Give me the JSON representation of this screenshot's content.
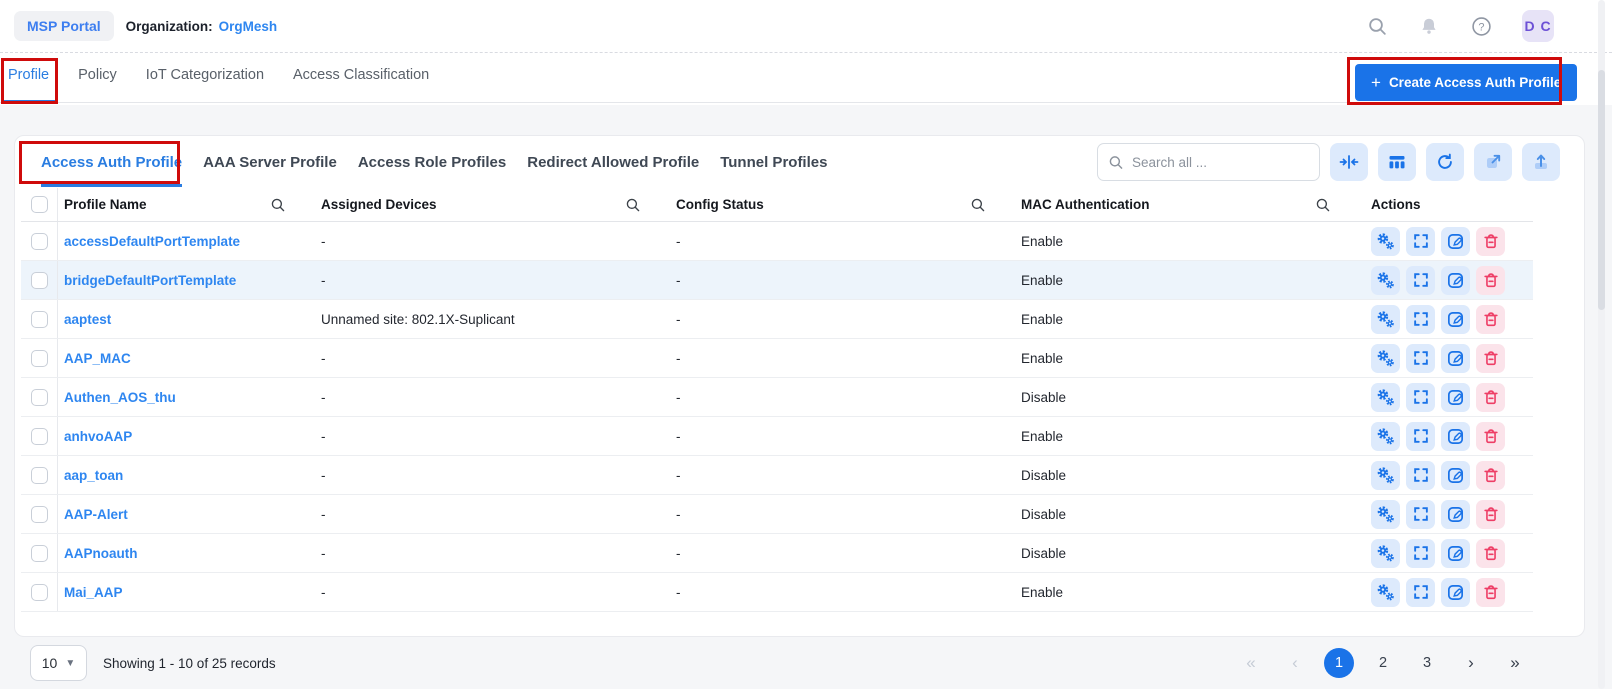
{
  "topbar": {
    "app_badge": "MSP Portal",
    "org_label": "Organization:",
    "org_value": "OrgMesh",
    "avatar_initials": "D C"
  },
  "tabs": {
    "items": [
      {
        "label": "Profile",
        "active": true
      },
      {
        "label": "Policy",
        "active": false
      },
      {
        "label": "IoT Categorization",
        "active": false
      },
      {
        "label": "Access Classification",
        "active": false
      }
    ],
    "create_button": {
      "plus": "+",
      "label": "Create Access Auth Profile"
    }
  },
  "subtabs": [
    "Access Auth Profile",
    "AAA Server Profile",
    "Access Role Profiles",
    "Redirect Allowed Profile",
    "Tunnel Profiles"
  ],
  "card": {
    "search_placeholder": "Search all ..."
  },
  "icons": {
    "topbar": [
      "search-icon",
      "bell-icon",
      "help-icon"
    ],
    "toolbar": [
      "collapse-columns-icon",
      "columns-icon",
      "refresh-icon",
      "open-external-icon",
      "upload-icon"
    ],
    "row_actions": [
      "settings-gears-icon",
      "expand-icon",
      "edit-icon",
      "delete-icon"
    ]
  },
  "table": {
    "columns": [
      "Profile Name",
      "Assigned Devices",
      "Config Status",
      "MAC Authentication",
      "Actions"
    ],
    "rows": [
      {
        "name": "accessDefaultPortTemplate",
        "assigned": "-",
        "config": "-",
        "mac": "Enable",
        "highlight": false
      },
      {
        "name": "bridgeDefaultPortTemplate",
        "assigned": "-",
        "config": "-",
        "mac": "Enable",
        "highlight": true
      },
      {
        "name": "aaptest",
        "assigned": "Unnamed site: 802.1X-Suplicant",
        "config": "-",
        "mac": "Enable",
        "highlight": false
      },
      {
        "name": "AAP_MAC",
        "assigned": "-",
        "config": "-",
        "mac": "Enable",
        "highlight": false
      },
      {
        "name": "Authen_AOS_thu",
        "assigned": "-",
        "config": "-",
        "mac": "Disable",
        "highlight": false
      },
      {
        "name": "anhvoAAP",
        "assigned": "-",
        "config": "-",
        "mac": "Enable",
        "highlight": false
      },
      {
        "name": "aap_toan",
        "assigned": "-",
        "config": "-",
        "mac": "Disable",
        "highlight": false
      },
      {
        "name": "AAP-Alert",
        "assigned": "-",
        "config": "-",
        "mac": "Disable",
        "highlight": false
      },
      {
        "name": "AAPnoauth",
        "assigned": "-",
        "config": "-",
        "mac": "Disable",
        "highlight": false
      },
      {
        "name": "Mai_AAP",
        "assigned": "-",
        "config": "-",
        "mac": "Enable",
        "highlight": false
      }
    ]
  },
  "footer": {
    "page_size": "10",
    "showing": "Showing 1 - 10 of 25 records",
    "pages": [
      "1",
      "2",
      "3"
    ],
    "current_page": "1",
    "pagination_icons": {
      "first": "«",
      "prev": "‹",
      "next": "›",
      "last": "»"
    }
  },
  "colors": {
    "accent_blue": "#1a73e8",
    "link_blue": "#2e86f0",
    "annotation_red": "#cf0b0b",
    "delete_red": "#ee3e66",
    "icon_bg_blue": "#ddeafc",
    "delete_bg": "#fbe3ea",
    "row_highlight": "#edf4fb",
    "stage_gray": "#f5f6f8",
    "avatar_bg": "#e7e3f7",
    "avatar_text": "#6d51d6"
  }
}
